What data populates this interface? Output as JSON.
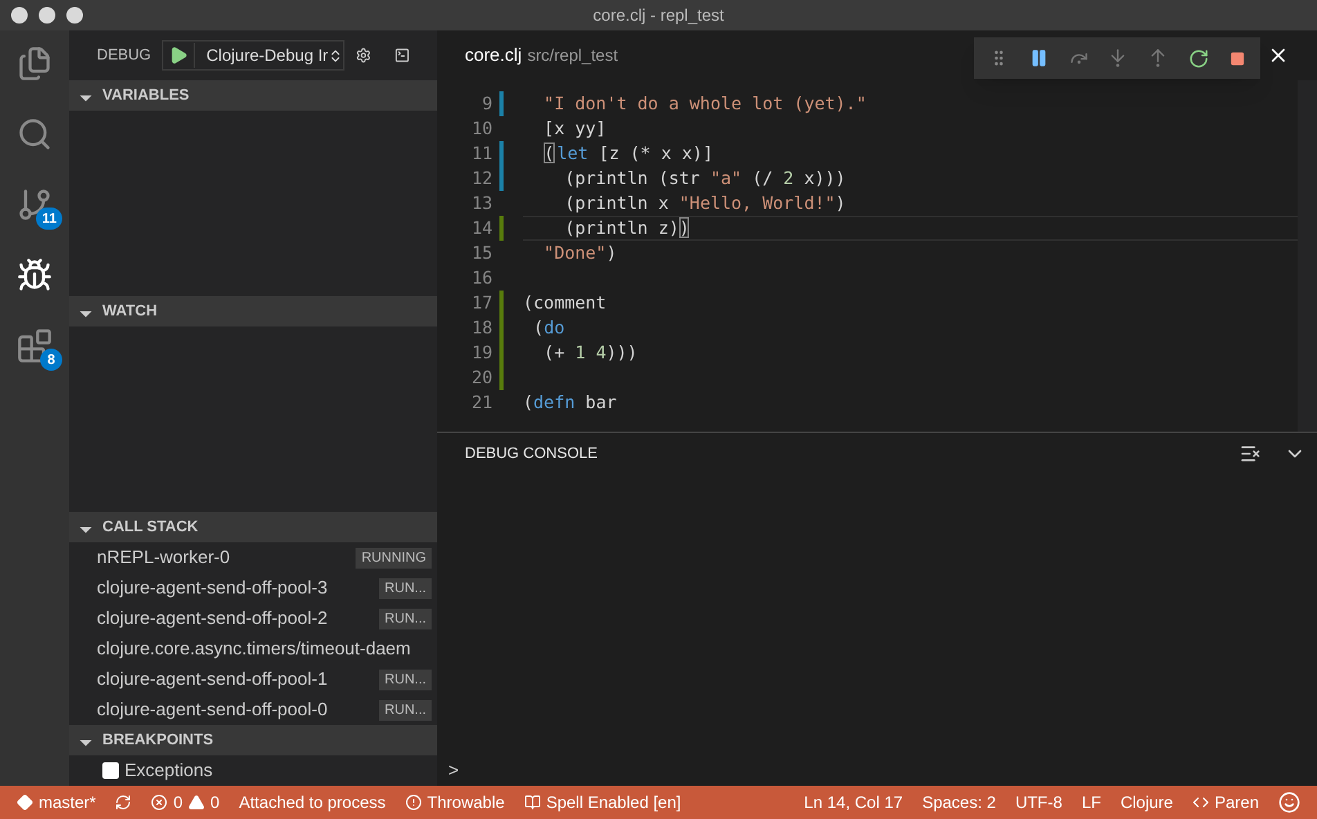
{
  "window": {
    "title": "core.clj - repl_test"
  },
  "activity_bar": [
    {
      "kind": "files",
      "selected": false
    },
    {
      "kind": "search",
      "selected": false
    },
    {
      "kind": "git",
      "selected": false,
      "badge": "11"
    },
    {
      "kind": "debug",
      "selected": true
    },
    {
      "kind": "extensions",
      "selected": false,
      "badge": "8"
    }
  ],
  "debug_header": {
    "title": "DEBUG",
    "configuration": "Clojure-Debug Ir"
  },
  "sections": {
    "variables": {
      "title": "VARIABLES",
      "expanded": true
    },
    "watch": {
      "title": "WATCH",
      "expanded": true
    },
    "call_stack": {
      "title": "CALL STACK",
      "expanded": true
    },
    "breakpoints": {
      "title": "BREAKPOINTS",
      "expanded": true
    }
  },
  "call_stack": [
    {
      "name": "nREPL-worker-0",
      "status": "RUNNING"
    },
    {
      "name": "clojure-agent-send-off-pool-3",
      "status": "RUN..."
    },
    {
      "name": "clojure-agent-send-off-pool-2",
      "status": "RUN..."
    },
    {
      "name": "clojure.core.async.timers/timeout-daem"
    },
    {
      "name": "clojure-agent-send-off-pool-1",
      "status": "RUN..."
    },
    {
      "name": "clojure-agent-send-off-pool-0",
      "status": "RUN..."
    }
  ],
  "breakpoints": [
    {
      "label": "Exceptions",
      "checked": false
    }
  ],
  "editor": {
    "file": "core.clj",
    "path": "src/repl_test",
    "lines": [
      {
        "number": "9",
        "kind": "modified",
        "current": false,
        "tokens": [
          {
            "text": "  \"I don't do a whole lot (yet).\"",
            "kind": "string"
          }
        ]
      },
      {
        "number": "10",
        "kind": "unchanged",
        "current": false,
        "tokens": [
          {
            "text": "  [x yy]",
            "kind": "plain"
          }
        ]
      },
      {
        "number": "11",
        "kind": "modified",
        "current": false,
        "tokens": [
          {
            "text": "  (",
            "kind": "bracket-match"
          },
          {
            "text": "let",
            "kind": "keyword"
          },
          {
            "text": " [z (* x x)]",
            "kind": "plain"
          }
        ]
      },
      {
        "number": "12",
        "kind": "modified",
        "current": false,
        "tokens": [
          {
            "text": "    (println (str ",
            "kind": "plain"
          },
          {
            "text": "\"a\"",
            "kind": "string"
          },
          {
            "text": " (/ ",
            "kind": "plain"
          },
          {
            "text": "2",
            "kind": "number"
          },
          {
            "text": " x)))",
            "kind": "plain"
          }
        ]
      },
      {
        "number": "13",
        "kind": "unchanged",
        "current": false,
        "tokens": [
          {
            "text": "    (println x ",
            "kind": "plain"
          },
          {
            "text": "\"Hello, World!\"",
            "kind": "string"
          },
          {
            "text": ")",
            "kind": "plain"
          }
        ]
      },
      {
        "number": "14",
        "kind": "added",
        "current": true,
        "tokens": [
          {
            "text": "    (println z)",
            "kind": "plain"
          },
          {
            "text": ")",
            "kind": "bracket-match"
          }
        ]
      },
      {
        "number": "15",
        "kind": "unchanged",
        "current": false,
        "tokens": [
          {
            "text": "  \"Done\"",
            "kind": "string"
          },
          {
            "text": ")",
            "kind": "plain"
          }
        ]
      },
      {
        "number": "16",
        "kind": "unchanged",
        "current": false
      },
      {
        "number": "17",
        "kind": "added",
        "current": false,
        "tokens": [
          {
            "text": "(comment",
            "kind": "plain"
          }
        ]
      },
      {
        "number": "18",
        "kind": "added",
        "current": false,
        "tokens": [
          {
            "text": " (",
            "kind": "plain"
          },
          {
            "text": "do",
            "kind": "keyword"
          }
        ]
      },
      {
        "number": "19",
        "kind": "added",
        "current": false,
        "tokens": [
          {
            "text": "  (+ ",
            "kind": "plain"
          },
          {
            "text": "1 4",
            "kind": "number"
          },
          {
            "text": ")))",
            "kind": "plain"
          }
        ]
      },
      {
        "number": "20",
        "kind": "added",
        "current": false
      },
      {
        "number": "21",
        "kind": "unchanged",
        "current": false,
        "tokens": [
          {
            "text": "(",
            "kind": "plain"
          },
          {
            "text": "defn",
            "kind": "keyword"
          },
          {
            "text": " bar",
            "kind": "plain"
          }
        ]
      }
    ]
  },
  "debug_console": {
    "title": "DEBUG CONSOLE",
    "prompt": ">"
  },
  "status_bar": {
    "left": [
      {
        "kind": "branch",
        "text": "master*"
      },
      {
        "kind": "sync"
      },
      {
        "kind": "problems",
        "errors": "0",
        "warnings": "0"
      },
      {
        "kind": "text",
        "text": "Attached to process"
      },
      {
        "kind": "exception",
        "text": "Throwable"
      },
      {
        "kind": "book",
        "text": "Spell Enabled [en]"
      }
    ],
    "right": [
      {
        "kind": "text",
        "text": "Ln 14, Col 17"
      },
      {
        "kind": "text",
        "text": "Spaces: 2"
      },
      {
        "kind": "text",
        "text": "UTF-8"
      },
      {
        "kind": "text",
        "text": "LF"
      },
      {
        "kind": "text",
        "text": "Clojure"
      },
      {
        "kind": "code",
        "text": "Paren"
      },
      {
        "kind": "smiley"
      }
    ]
  }
}
